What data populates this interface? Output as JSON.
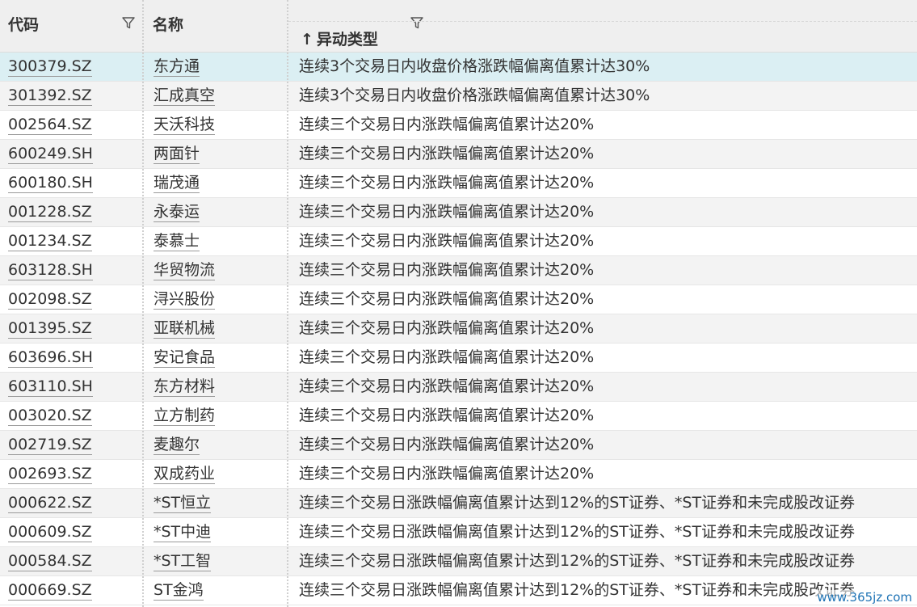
{
  "header": {
    "code_label": "代码",
    "name_label": "名称",
    "type_label": "异动类型",
    "sort_arrow": "↑"
  },
  "rows": [
    {
      "code": "300379.SZ",
      "name": "东方通",
      "type": "连续3个交易日内收盘价格涨跌幅偏离值累计达30%"
    },
    {
      "code": "301392.SZ",
      "name": "汇成真空",
      "type": "连续3个交易日内收盘价格涨跌幅偏离值累计达30%"
    },
    {
      "code": "002564.SZ",
      "name": "天沃科技",
      "type": "连续三个交易日内涨跌幅偏离值累计达20%"
    },
    {
      "code": "600249.SH",
      "name": "两面针",
      "type": "连续三个交易日内涨跌幅偏离值累计达20%"
    },
    {
      "code": "600180.SH",
      "name": "瑞茂通",
      "type": "连续三个交易日内涨跌幅偏离值累计达20%"
    },
    {
      "code": "001228.SZ",
      "name": "永泰运",
      "type": "连续三个交易日内涨跌幅偏离值累计达20%"
    },
    {
      "code": "001234.SZ",
      "name": "泰慕士",
      "type": "连续三个交易日内涨跌幅偏离值累计达20%"
    },
    {
      "code": "603128.SH",
      "name": "华贸物流",
      "type": "连续三个交易日内涨跌幅偏离值累计达20%"
    },
    {
      "code": "002098.SZ",
      "name": "浔兴股份",
      "type": "连续三个交易日内涨跌幅偏离值累计达20%"
    },
    {
      "code": "001395.SZ",
      "name": "亚联机械",
      "type": "连续三个交易日内涨跌幅偏离值累计达20%"
    },
    {
      "code": "603696.SH",
      "name": "安记食品",
      "type": "连续三个交易日内涨跌幅偏离值累计达20%"
    },
    {
      "code": "603110.SH",
      "name": "东方材料",
      "type": "连续三个交易日内涨跌幅偏离值累计达20%"
    },
    {
      "code": "003020.SZ",
      "name": "立方制药",
      "type": "连续三个交易日内涨跌幅偏离值累计达20%"
    },
    {
      "code": "002719.SZ",
      "name": "麦趣尔",
      "type": "连续三个交易日内涨跌幅偏离值累计达20%"
    },
    {
      "code": "002693.SZ",
      "name": "双成药业",
      "type": "连续三个交易日内涨跌幅偏离值累计达20%"
    },
    {
      "code": "000622.SZ",
      "name": "*ST恒立",
      "type": "连续三个交易日涨跌幅偏离值累计达到12%的ST证券、*ST证券和未完成股改证券"
    },
    {
      "code": "000609.SZ",
      "name": "*ST中迪",
      "type": "连续三个交易日涨跌幅偏离值累计达到12%的ST证券、*ST证券和未完成股改证券"
    },
    {
      "code": "000584.SZ",
      "name": "*ST工智",
      "type": "连续三个交易日涨跌幅偏离值累计达到12%的ST证券、*ST证券和未完成股改证券"
    },
    {
      "code": "000669.SZ",
      "name": "ST金鸿",
      "type": "连续三个交易日涨跌幅偏离值累计达到12%的ST证券、*ST证券和未完成股改证券"
    }
  ],
  "watermark": "www.365jz.com",
  "colors": {
    "header_bg": "#efefef",
    "selected_row_bg": "#dbeff3",
    "alt_row_bg": "#f3f3f3",
    "text": "#333333",
    "watermark": "#1e73b5"
  }
}
